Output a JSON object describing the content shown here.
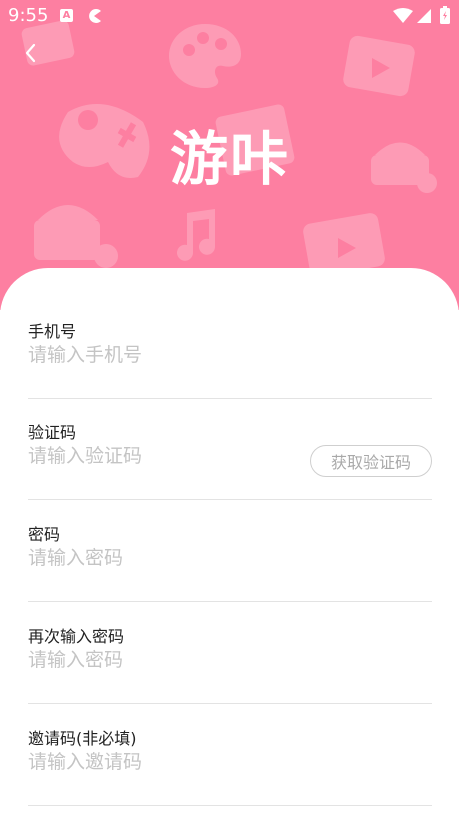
{
  "status_bar": {
    "time": "9:55",
    "a_badge": "A",
    "icons": [
      "a-badge-icon",
      "pacman-icon",
      "wifi-icon",
      "signal-icon",
      "battery-icon"
    ]
  },
  "header": {
    "app_name": "游咔",
    "background_color": "#fd7fa1",
    "back_icon": "chevron-left-icon"
  },
  "form": {
    "fields": [
      {
        "label": "手机号",
        "placeholder": "请输入手机号",
        "value": ""
      },
      {
        "label": "验证码",
        "placeholder": "请输入验证码",
        "value": "",
        "button": "获取验证码"
      },
      {
        "label": "密码",
        "placeholder": "请输入密码",
        "value": ""
      },
      {
        "label": "再次输入密码",
        "placeholder": "请输入密码",
        "value": ""
      },
      {
        "label": "邀请码(非必填)",
        "placeholder": "请输入邀请码",
        "value": ""
      }
    ]
  }
}
